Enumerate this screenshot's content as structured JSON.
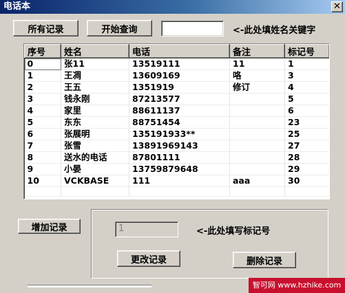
{
  "window": {
    "title": "电话本",
    "close_glyph": "✕"
  },
  "toolbar": {
    "all_records_label": "所有记录",
    "start_query_label": "开始查询",
    "query_value": "",
    "query_hint": "<-此处填姓名关键字"
  },
  "table": {
    "columns": [
      "序号",
      "姓名",
      "电话",
      "备注",
      "标记号"
    ],
    "rows": [
      [
        "0",
        "张11",
        "13519111",
        "11",
        "1"
      ],
      [
        "1",
        "王凋",
        "13609169",
        "咯",
        "3"
      ],
      [
        "2",
        "王五",
        "1351919",
        "修订",
        "4"
      ],
      [
        "3",
        "钱永刚",
        "87213577",
        "",
        "5"
      ],
      [
        "4",
        "家里",
        "88611137",
        "",
        "6"
      ],
      [
        "5",
        "东东",
        "88751454",
        "",
        "23"
      ],
      [
        "6",
        "张展明",
        "135191933**",
        "",
        "25"
      ],
      [
        "7",
        "张雪",
        "13891969143",
        "",
        "27"
      ],
      [
        "8",
        "送水的电话",
        "87801111",
        "",
        "28"
      ],
      [
        "9",
        "小晏",
        "13759879648",
        "",
        "29"
      ],
      [
        "10",
        "VCKBASE",
        "111",
        "aaa",
        "30"
      ]
    ]
  },
  "edit_panel": {
    "add_record_label": "增加记录",
    "mark_value": "1",
    "mark_hint": "<-此处填写标记号",
    "update_record_label": "更改记录",
    "delete_record_label": "删除记录"
  },
  "watermark": {
    "text": "智可网 www.hzhike.com"
  }
}
